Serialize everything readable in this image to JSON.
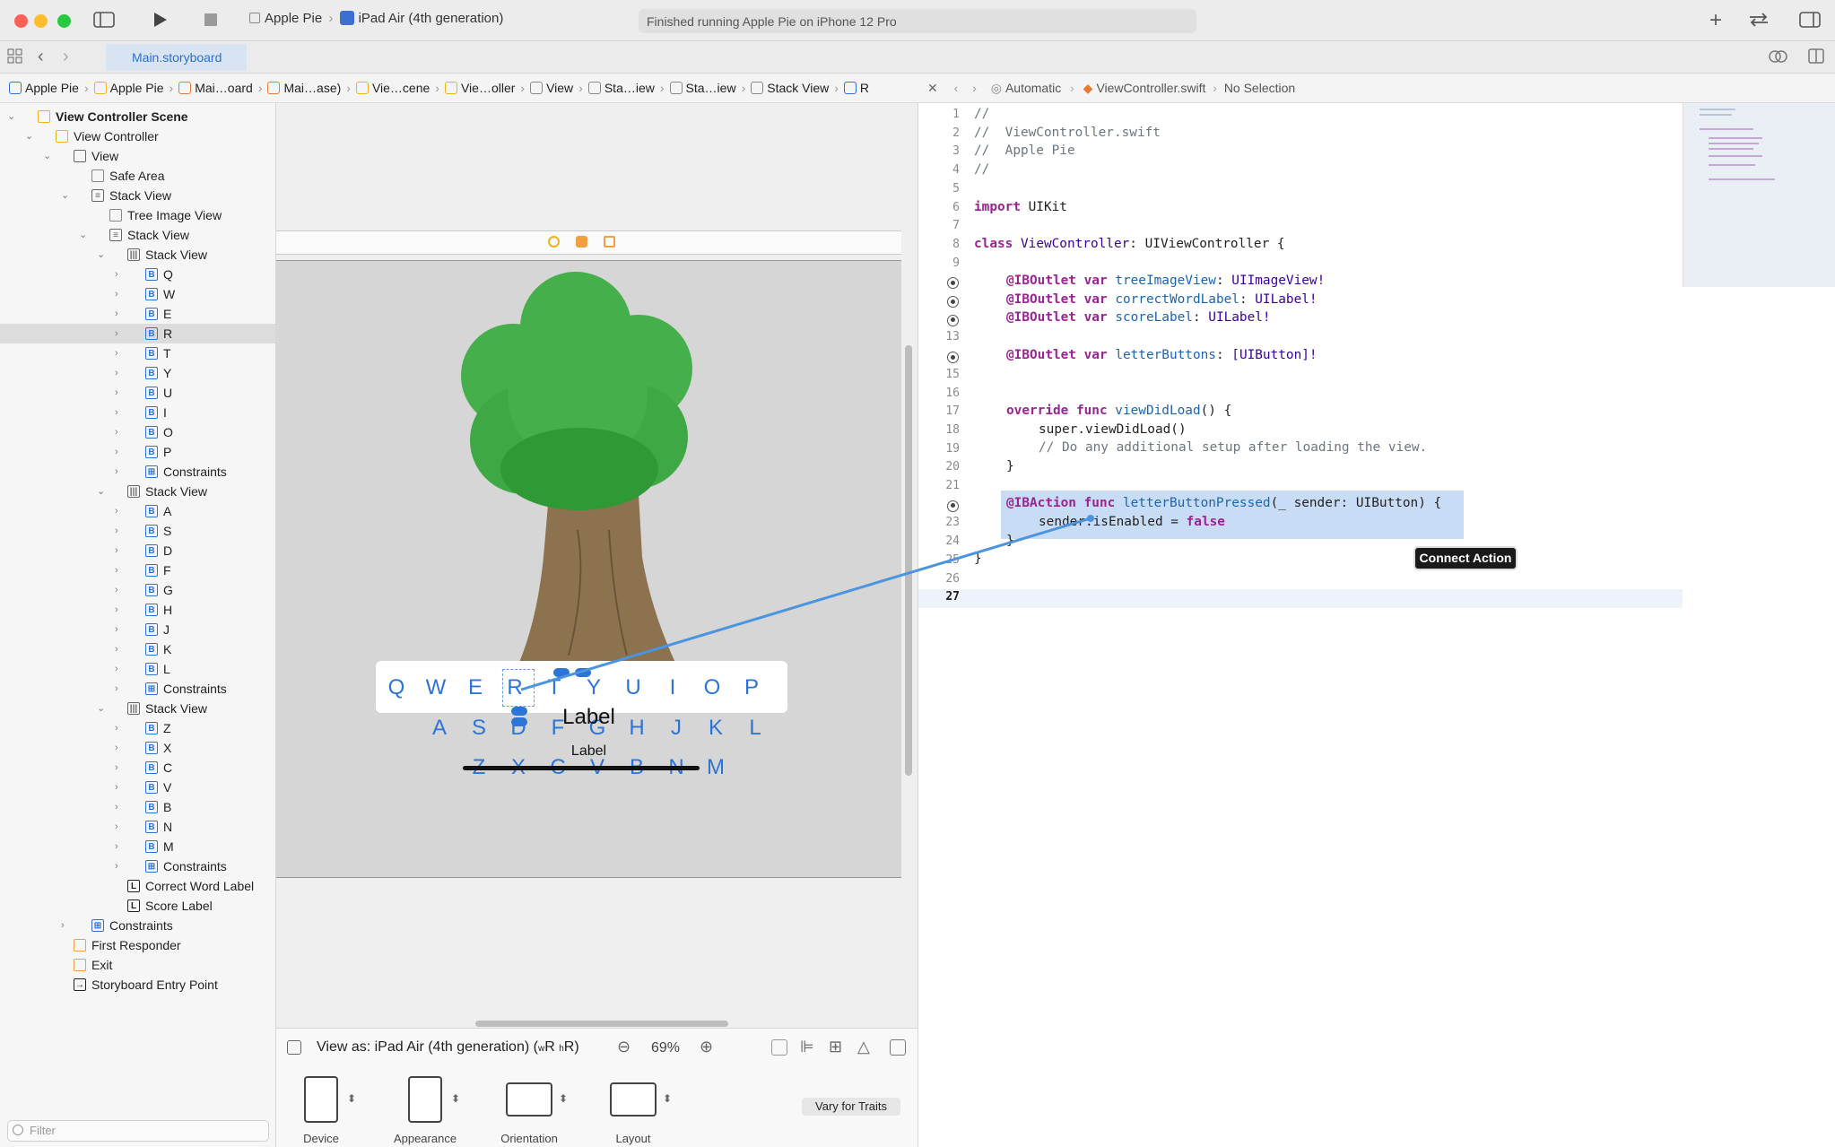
{
  "window": {
    "scheme_project": "Apple Pie",
    "scheme_device": "iPad Air (4th generation)",
    "activity_status": "Finished running Apple Pie on iPhone 12 Pro"
  },
  "tabs": [
    {
      "label": "Main.storyboard"
    }
  ],
  "breadcrumb": [
    "Apple Pie",
    "Apple Pie",
    "Mai…oard",
    "Mai…ase)",
    "Vie…cene",
    "Vie…oller",
    "View",
    "Sta…iew",
    "Sta…iew",
    "Stack View",
    "R"
  ],
  "code_jumpbar": {
    "mode": "Automatic",
    "file": "ViewController.swift",
    "selection": "No Selection"
  },
  "outline": {
    "rows": [
      {
        "label": "View Controller Scene",
        "icon": "scene-icon"
      },
      {
        "label": "View Controller",
        "icon": "view-controller-icon"
      },
      {
        "label": "View",
        "icon": "view-icon"
      },
      {
        "label": "Safe Area",
        "icon": "safe-area-icon"
      },
      {
        "label": "Stack View",
        "icon": "vertical-stack-icon"
      },
      {
        "label": "Tree Image View",
        "icon": "image-view-icon"
      },
      {
        "label": "Stack View",
        "icon": "vertical-stack-icon"
      },
      {
        "label": "Stack View",
        "icon": "horizontal-stack-icon"
      },
      {
        "label": "Q",
        "icon": "button-icon"
      },
      {
        "label": "W",
        "icon": "button-icon"
      },
      {
        "label": "E",
        "icon": "button-icon"
      },
      {
        "label": "R",
        "icon": "button-icon",
        "selected": true
      },
      {
        "label": "T",
        "icon": "button-icon"
      },
      {
        "label": "Y",
        "icon": "button-icon"
      },
      {
        "label": "U",
        "icon": "button-icon"
      },
      {
        "label": "I",
        "icon": "button-icon"
      },
      {
        "label": "O",
        "icon": "button-icon"
      },
      {
        "label": "P",
        "icon": "button-icon"
      },
      {
        "label": "Constraints",
        "icon": "constraints-icon"
      },
      {
        "label": "Stack View",
        "icon": "horizontal-stack-icon"
      },
      {
        "label": "A",
        "icon": "button-icon"
      },
      {
        "label": "S",
        "icon": "button-icon"
      },
      {
        "label": "D",
        "icon": "button-icon"
      },
      {
        "label": "F",
        "icon": "button-icon"
      },
      {
        "label": "G",
        "icon": "button-icon"
      },
      {
        "label": "H",
        "icon": "button-icon"
      },
      {
        "label": "J",
        "icon": "button-icon"
      },
      {
        "label": "K",
        "icon": "button-icon"
      },
      {
        "label": "L",
        "icon": "button-icon"
      },
      {
        "label": "Constraints",
        "icon": "constraints-icon"
      },
      {
        "label": "Stack View",
        "icon": "horizontal-stack-icon"
      },
      {
        "label": "Z",
        "icon": "button-icon"
      },
      {
        "label": "X",
        "icon": "button-icon"
      },
      {
        "label": "C",
        "icon": "button-icon"
      },
      {
        "label": "V",
        "icon": "button-icon"
      },
      {
        "label": "B",
        "icon": "button-icon"
      },
      {
        "label": "N",
        "icon": "button-icon"
      },
      {
        "label": "M",
        "icon": "button-icon"
      },
      {
        "label": "Constraints",
        "icon": "constraints-icon"
      },
      {
        "label": "Correct Word Label",
        "icon": "label-icon"
      },
      {
        "label": "Score Label",
        "icon": "label-icon"
      },
      {
        "label": "Constraints",
        "icon": "constraints-icon"
      },
      {
        "label": "First Responder",
        "icon": "first-responder-icon"
      },
      {
        "label": "Exit",
        "icon": "exit-icon"
      },
      {
        "label": "Storyboard Entry Point",
        "icon": "arrow-right-icon"
      }
    ],
    "filter_placeholder": "Filter"
  },
  "canvas": {
    "keyboard_rows": [
      [
        "Q",
        "W",
        "E",
        "R",
        "T",
        "Y",
        "U",
        "I",
        "O",
        "P"
      ],
      [
        "A",
        "S",
        "D",
        "F",
        "G",
        "H",
        "J",
        "K",
        "L"
      ],
      [
        "Z",
        "X",
        "C",
        "V",
        "B",
        "N",
        "M"
      ]
    ],
    "correct_word_label": "Label",
    "score_label": "Label",
    "view_as": "View as: iPad Air (4th generation)",
    "size_class_w": "R",
    "size_class_h": "R",
    "zoom": "69%"
  },
  "traits": {
    "device": "Device",
    "appearance": "Appearance",
    "orientation": "Orientation",
    "layout": "Layout",
    "vary_button": "Vary for Traits"
  },
  "editor": {
    "line_numbers": [
      "1",
      "2",
      "3",
      "4",
      "5",
      "6",
      "7",
      "8",
      "9",
      "",
      "",
      "",
      "13",
      "",
      "15",
      "16",
      "17",
      "18",
      "19",
      "20",
      "21",
      "",
      "23",
      "24",
      "25",
      "26",
      "27"
    ],
    "code": {
      "l1": "//",
      "l2": "//  ViewController.swift",
      "l3": "//  Apple Pie",
      "l4": "//",
      "l6_kw": "import",
      "l6_name": " UIKit",
      "l8_kw": "class",
      "l8_name": " ViewController",
      "l8_rest": ": UIViewController {",
      "outlets": [
        {
          "name": "treeImageView",
          "type": "UIImageView!"
        },
        {
          "name": "correctWordLabel",
          "type": "UILabel!"
        },
        {
          "name": "scoreLabel",
          "type": "UILabel!"
        },
        {
          "name": "letterButtons",
          "type": "[UIButton]!"
        }
      ],
      "l17_kw": "override func",
      "l17_name": " viewDidLoad",
      "l17_rest": "() {",
      "l18": "super.viewDidLoad()",
      "l19": "// Do any additional setup after loading the view.",
      "l20": "}",
      "l22_kw": "@IBAction func",
      "l22_name": " letterButtonPressed",
      "l22_rest": "(_ sender: UIButton) {",
      "l23_a": "sender.isEnabled = ",
      "l23_kw": "false",
      "l24": "}",
      "l25": "}"
    },
    "tooltip": "Connect Action"
  },
  "colors": {
    "accent": "#2c74d6",
    "selection_highlight": "#c9dcf6",
    "keyword": "#9b2393",
    "tree_green": "#45b04b",
    "tree_trunk": "#8d7250"
  }
}
